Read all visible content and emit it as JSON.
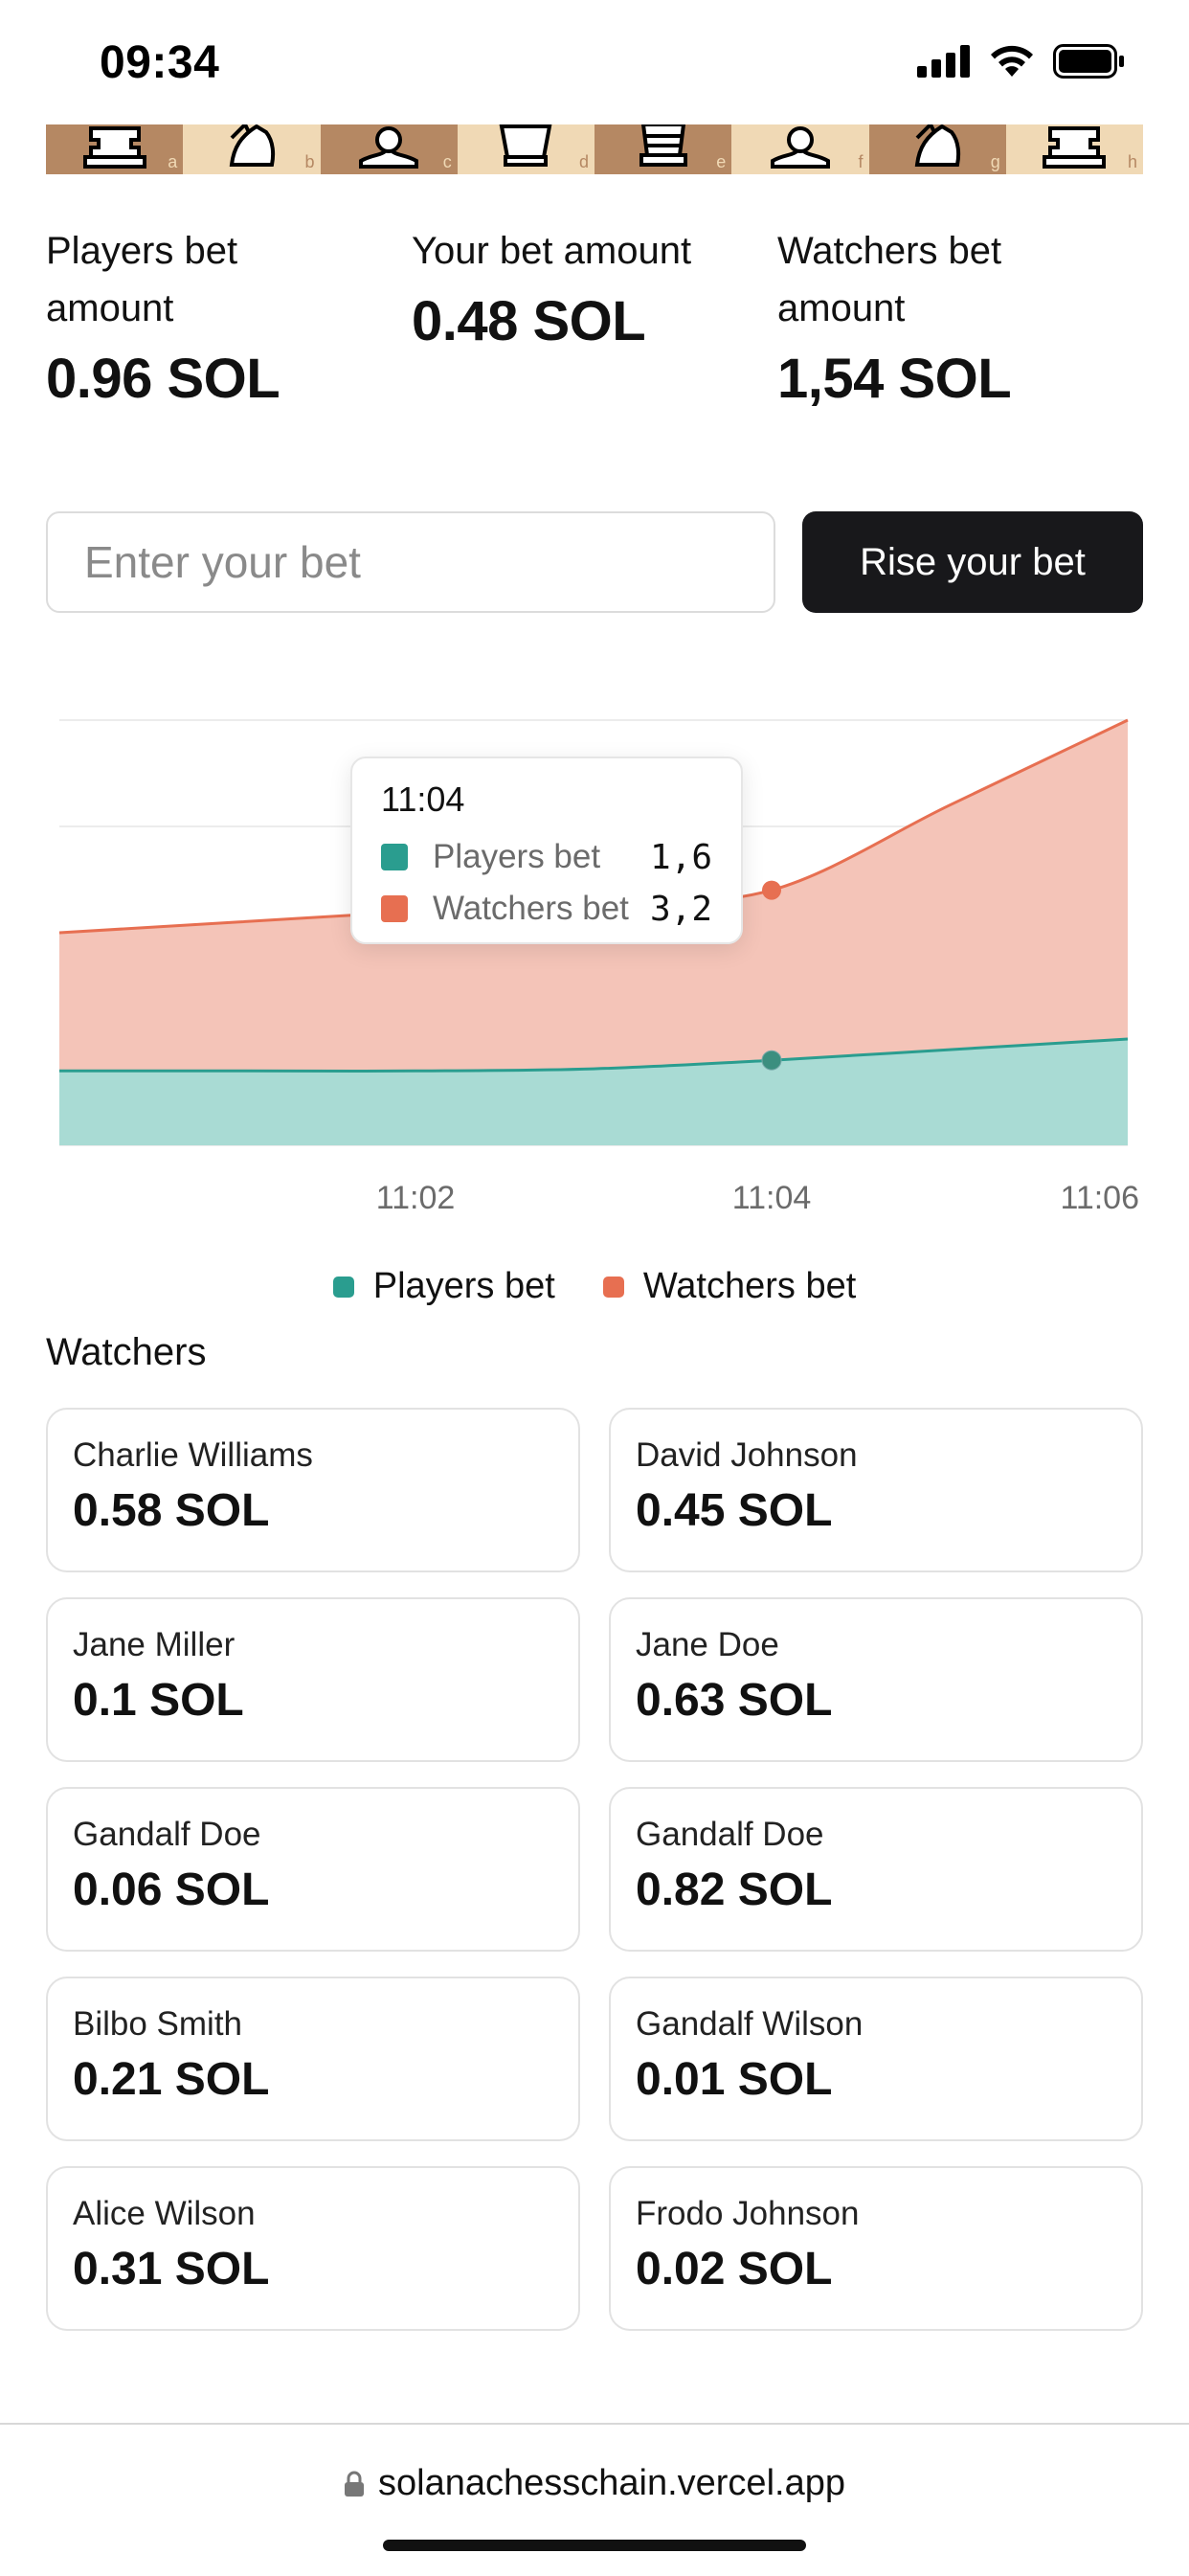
{
  "status_bar": {
    "time": "09:34",
    "icons": [
      "signal-icon",
      "wifi-icon",
      "battery-icon"
    ]
  },
  "board": {
    "files": [
      "a",
      "b",
      "c",
      "d",
      "e",
      "f",
      "g",
      "h"
    ],
    "pieces": [
      "rook-icon",
      "knight-icon",
      "bishop-icon",
      "queen-icon",
      "king-icon",
      "bishop-icon",
      "knight-icon",
      "rook-icon"
    ]
  },
  "stats": [
    {
      "label": "Players bet amount",
      "value": "0.96 SOL"
    },
    {
      "label": "Your bet amount",
      "value": "0.48 SOL"
    },
    {
      "label": "Watchers bet amount",
      "value": "1,54 SOL"
    }
  ],
  "bet_form": {
    "placeholder": "Enter your bet",
    "value": "",
    "button_label": "Rise your bet"
  },
  "colors": {
    "players": "#2a9d8f",
    "watchers": "#e76f51",
    "players_fill": "#a9dbd4",
    "watchers_fill": "#f4c4b8"
  },
  "chart_data": {
    "type": "area",
    "stacked": true,
    "x": [
      "11:00",
      "11:01",
      "11:02",
      "11:03",
      "11:04",
      "11:05",
      "11:06"
    ],
    "x_ticks": [
      "11:02",
      "11:04",
      "11:06"
    ],
    "series": [
      {
        "name": "Players bet",
        "values": [
          0.7,
          0.7,
          0.7,
          0.72,
          0.8,
          0.9,
          1.0
        ]
      },
      {
        "name": "Watchers bet",
        "values": [
          1.3,
          1.4,
          1.5,
          1.55,
          1.6,
          2.3,
          3.0
        ]
      }
    ],
    "ylim": [
      0,
      4
    ],
    "grid": true,
    "legend_position": "bottom",
    "tooltip": {
      "time": "11:04",
      "rows": [
        {
          "name": "Players bet",
          "value": "1,6"
        },
        {
          "name": "Watchers bet",
          "value": "3,2"
        }
      ]
    }
  },
  "watchers": {
    "title": "Watchers",
    "items": [
      {
        "name": "Charlie Williams",
        "amount": "0.58 SOL"
      },
      {
        "name": "David Johnson",
        "amount": "0.45 SOL"
      },
      {
        "name": "Jane Miller",
        "amount": "0.1 SOL"
      },
      {
        "name": "Jane Doe",
        "amount": "0.63 SOL"
      },
      {
        "name": "Gandalf Doe",
        "amount": "0.06 SOL"
      },
      {
        "name": "Gandalf Doe",
        "amount": "0.82 SOL"
      },
      {
        "name": "Bilbo Smith",
        "amount": "0.21 SOL"
      },
      {
        "name": "Gandalf Wilson",
        "amount": "0.01 SOL"
      },
      {
        "name": "Alice Wilson",
        "amount": "0.31 SOL"
      },
      {
        "name": "Frodo Johnson",
        "amount": "0.02 SOL"
      }
    ]
  },
  "browser": {
    "url": "solanachesschain.vercel.app",
    "icon": "lock-icon"
  }
}
